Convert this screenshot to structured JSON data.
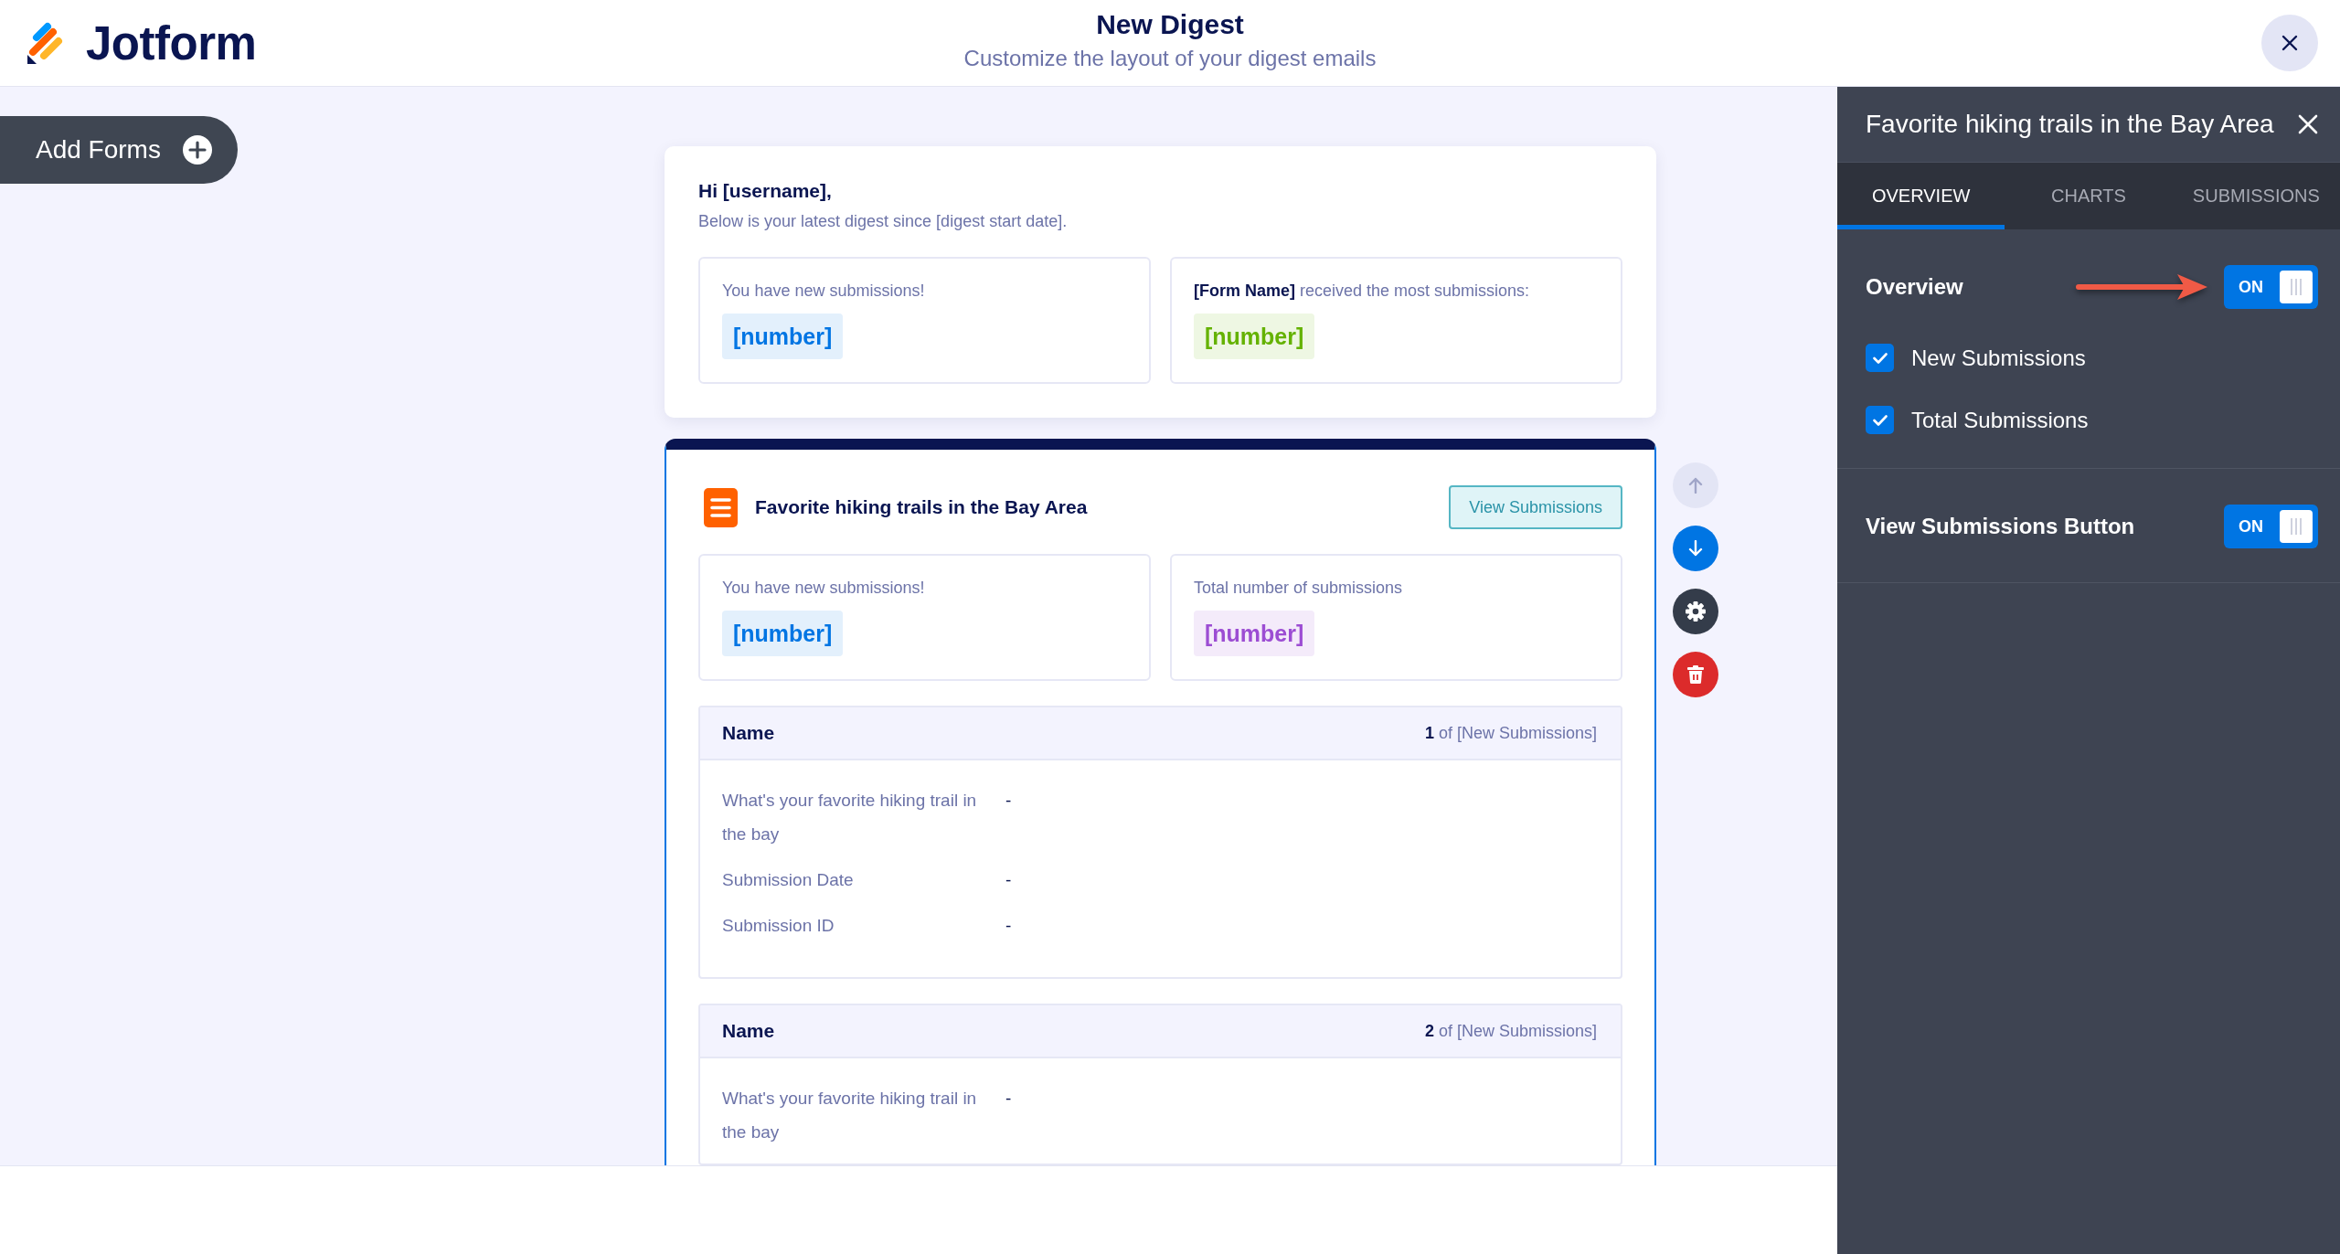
{
  "header": {
    "logo_text": "Jotform",
    "title": "New Digest",
    "subtitle": "Customize the layout of your digest emails"
  },
  "add_forms_button": {
    "label": "Add Forms"
  },
  "greeting_card": {
    "greeting": "Hi [username],",
    "intro": "Below is your latest digest since [digest start date].",
    "stats": [
      {
        "label": "You have new submissions!",
        "value": "[number]",
        "color": "#0075e3"
      },
      {
        "label": "**[Form Name]** received the most submissions:",
        "value": "[number]",
        "color": "#64b200"
      }
    ]
  },
  "form_card": {
    "title": "Favorite hiking trails in the Bay Area",
    "view_button": "View Submissions",
    "stats": [
      {
        "label": "You have new submissions!",
        "value": "[number]",
        "color": "#0075e3"
      },
      {
        "label": "Total number of submissions",
        "value": "[number]",
        "color": "#9c4dd3"
      }
    ],
    "submissions": [
      {
        "title": "Name",
        "counter": "**1** of [New Submissions]",
        "fields": [
          {
            "label": "What's your favorite hiking trail in the bay",
            "value": "-"
          },
          {
            "label": "Submission Date",
            "value": "-"
          },
          {
            "label": "Submission ID",
            "value": "-"
          }
        ]
      },
      {
        "title": "Name",
        "counter": "**2** of [New Submissions]",
        "fields": [
          {
            "label": "What's your favorite hiking trail in the bay",
            "value": "-"
          }
        ]
      }
    ]
  },
  "card_actions": [
    {
      "kind": "move_up",
      "disabled": true
    },
    {
      "kind": "move_down",
      "disabled": false
    },
    {
      "kind": "settings",
      "disabled": false
    },
    {
      "kind": "delete",
      "disabled": false
    }
  ],
  "panel": {
    "title": "Favorite hiking trails in the Bay Area",
    "tabs": [
      {
        "label": "OVERVIEW",
        "selected": true
      },
      {
        "label": "CHARTS",
        "selected": false
      },
      {
        "label": "SUBMISSIONS",
        "selected": false
      }
    ],
    "sections": [
      {
        "title": "Overview",
        "annotated": true,
        "toggle": {
          "label": "ON",
          "on": true
        },
        "options": [
          {
            "label": "New Submissions",
            "checked": true
          },
          {
            "label": "Total Submissions",
            "checked": true
          }
        ]
      },
      {
        "title": "View Submissions Button",
        "annotated": false,
        "toggle": {
          "label": "ON",
          "on": true
        }
      }
    ]
  }
}
